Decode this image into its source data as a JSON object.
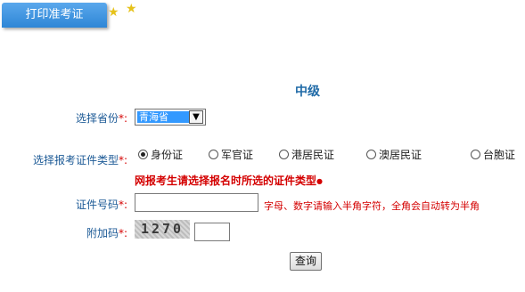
{
  "tab": {
    "label": "打印准考证"
  },
  "heading": "中级",
  "province": {
    "label": "选择省份",
    "required_mark": "*:",
    "selected": "青海省"
  },
  "cert_type": {
    "label": "选择报考证件类型",
    "required_mark": "*:",
    "options": [
      "身份证",
      "军官证",
      "港居民证",
      "澳居民证",
      "台胞证"
    ],
    "selected_index": 0
  },
  "warning": {
    "text": "网报考生请选择报名时所选的证件类型",
    "bullet": "●"
  },
  "cert_number": {
    "label": "证件号码",
    "required_mark": "*:",
    "value": "",
    "hint": "字母、数字请输入半角字符，全角会自动转为半角"
  },
  "captcha": {
    "label": "附加码",
    "required_mark": "*:",
    "image_text": "1270",
    "value": ""
  },
  "submit": {
    "label": "查询"
  },
  "colors": {
    "tab": "#3a94e0",
    "label": "#1c5a96",
    "warning": "#d40000",
    "heading": "#1f6aa7"
  }
}
